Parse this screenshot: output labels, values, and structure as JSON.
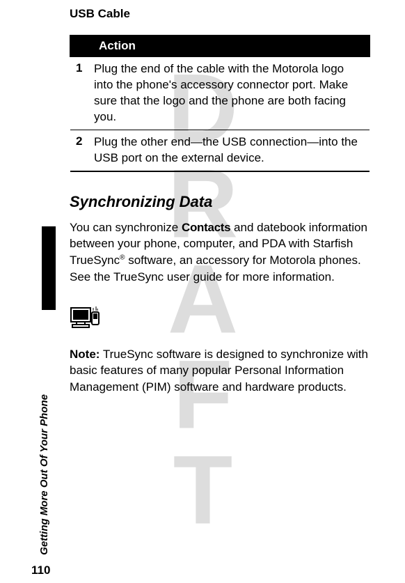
{
  "watermark": "DRAFT",
  "section_title": "USB Cable",
  "table": {
    "header": "Action",
    "rows": [
      {
        "num": "1",
        "text": "Plug the end of the cable with the Motorola logo into the phone's accessory connector port. Make sure that the logo and the phone are both facing you."
      },
      {
        "num": "2",
        "text": "Plug the other end—the USB connection—into the USB port on the external device."
      }
    ]
  },
  "subheading": "Synchronizing Data",
  "para_intro_pre": "You can synchronize ",
  "para_intro_bold": "Contacts",
  "para_intro_post": " and datebook information between your phone, computer, and PDA with Starfish TrueSync",
  "para_intro_after_reg": " software, an accessory for Motorola phones. See the TrueSync user guide for more information.",
  "reg_mark": "®",
  "note_label": "Note:",
  "note_text": " TrueSync software is designed to synchronize with basic features of many popular Personal Information Management (PIM) software and hardware products.",
  "side_label": "Getting More Out Of Your Phone",
  "page_number": "110",
  "icon_name": "computer-phone-sync-icon"
}
